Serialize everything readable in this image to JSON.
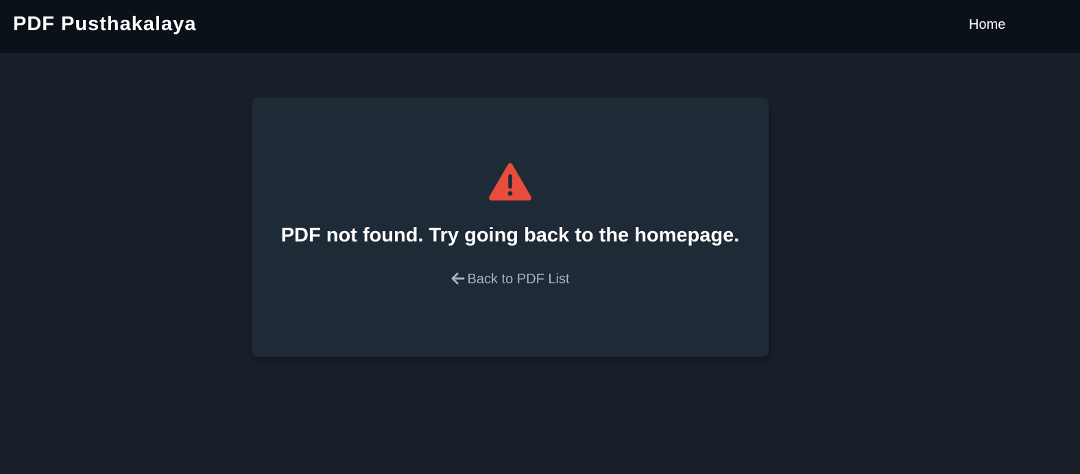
{
  "header": {
    "brand": "PDF Pusthakalaya",
    "nav": [
      {
        "label": "Home"
      }
    ]
  },
  "error_card": {
    "icon": "warning-triangle-icon",
    "message": "PDF not found. Try going back to the homepage.",
    "back_link": {
      "icon": "arrow-left-icon",
      "label": "Back to PDF List"
    }
  },
  "colors": {
    "page_bg": "#18202a",
    "topbar_bg": "#0b1119",
    "card_bg": "#1f2a37",
    "warning": "#e74c3c",
    "link": "#a7b3c2"
  }
}
